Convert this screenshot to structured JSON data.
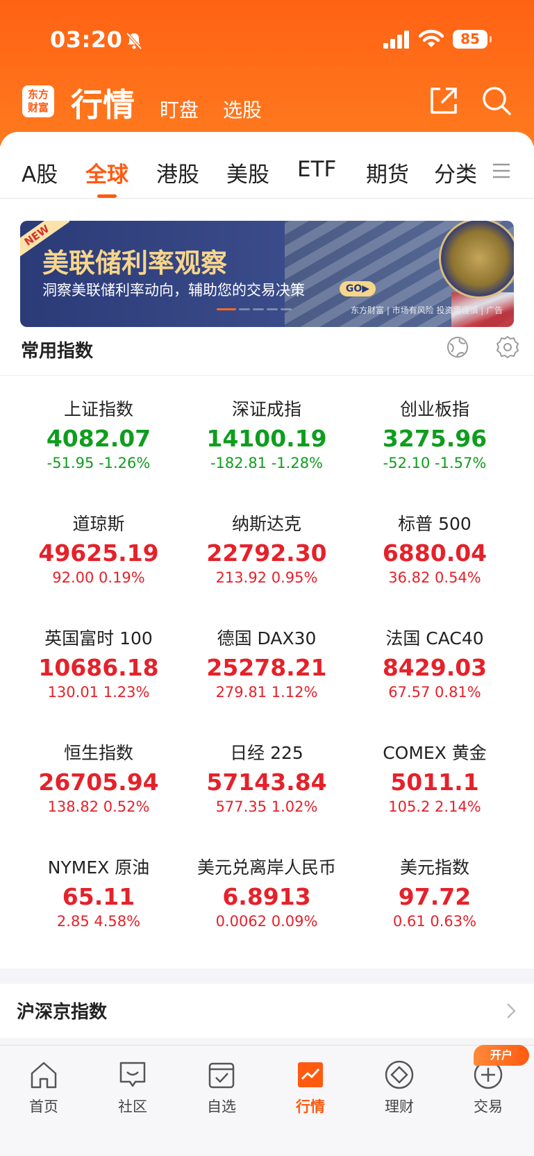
{
  "status_bar": {
    "time": "03:20",
    "battery": "85"
  },
  "app_bar": {
    "logo_line1": "东方",
    "logo_line2": "财富",
    "title": "行情",
    "sub_tabs": [
      "盯盘",
      "选股"
    ]
  },
  "market_tabs": [
    "A股",
    "全球",
    "港股",
    "美股",
    "ETF",
    "期货",
    "分类"
  ],
  "active_tab": "全球",
  "banner": {
    "badge": "NEW",
    "title": "美联储利率观察",
    "subtitle": "洞察美联储利率动向，辅助您的交易决策",
    "go_label": "GO▶",
    "footer": "东方财富 | 市场有风险 投资需谨慎 | 广告"
  },
  "common_index": {
    "title": "常用指数",
    "items": [
      {
        "name": "上证指数",
        "value": "4082.07",
        "change": "-51.95  -1.26%",
        "direction": "down"
      },
      {
        "name": "深证成指",
        "value": "14100.19",
        "change": "-182.81  -1.28%",
        "direction": "down"
      },
      {
        "name": "创业板指",
        "value": "3275.96",
        "change": "-52.10  -1.57%",
        "direction": "down"
      },
      {
        "name": "道琼斯",
        "value": "49625.19",
        "change": "92.00  0.19%",
        "direction": "up"
      },
      {
        "name": "纳斯达克",
        "value": "22792.30",
        "change": "213.92  0.95%",
        "direction": "up"
      },
      {
        "name": "标普 500",
        "value": "6880.04",
        "change": "36.82  0.54%",
        "direction": "up"
      },
      {
        "name": "英国富时 100",
        "value": "10686.18",
        "change": "130.01  1.23%",
        "direction": "up"
      },
      {
        "name": "德国 DAX30",
        "value": "25278.21",
        "change": "279.81  1.12%",
        "direction": "up"
      },
      {
        "name": "法国 CAC40",
        "value": "8429.03",
        "change": "67.57  0.81%",
        "direction": "up"
      },
      {
        "name": "恒生指数",
        "value": "26705.94",
        "change": "138.82  0.52%",
        "direction": "up"
      },
      {
        "name": "日经 225",
        "value": "57143.84",
        "change": "577.35  1.02%",
        "direction": "up"
      },
      {
        "name": "COMEX 黄金",
        "value": "5011.1",
        "change": "105.2  2.14%",
        "direction": "up"
      },
      {
        "name": "NYMEX 原油",
        "value": "65.11",
        "change": "2.85  4.58%",
        "direction": "up"
      },
      {
        "name": "美元兑离岸人民币",
        "value": "6.8913",
        "change": "0.0062  0.09%",
        "direction": "up"
      },
      {
        "name": "美元指数",
        "value": "97.72",
        "change": "0.61  0.63%",
        "direction": "up"
      }
    ]
  },
  "next_section": {
    "title": "沪深京指数"
  },
  "bottom_nav": {
    "items": [
      "首页",
      "社区",
      "自选",
      "行情",
      "理财",
      "交易"
    ],
    "active": "行情",
    "open_badge": "开户"
  },
  "colors": {
    "brand": "#ff5a10",
    "up": "#e5212a",
    "down": "#0f9d1e"
  }
}
